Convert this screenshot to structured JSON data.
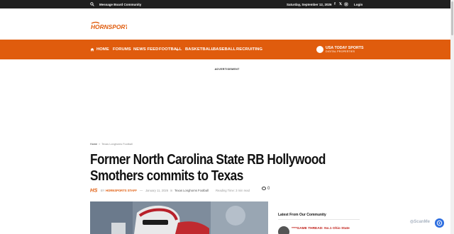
{
  "topbar": {
    "message_board": "Message Board Community",
    "date": "Saturday, September 12, 2026",
    "login": "Login",
    "social": [
      "facebook-icon",
      "x-icon",
      "instagram-icon"
    ]
  },
  "logo": {
    "text": "HORNSPORTS"
  },
  "nav": {
    "items": [
      "HOME",
      "FORUMS",
      "NEWS FEED",
      "FOOTBALL",
      "BASKETBALL",
      "BASEBALL",
      "RECRUITING"
    ],
    "partner_title": "USA TODAY SPORTS",
    "partner_sub": "DIGITAL PROPERTIES"
  },
  "advertisement": "ADVERTISEMENT",
  "breadcrumb": {
    "home": "Home",
    "separator": "»",
    "category": "Texas Longhorns Football"
  },
  "article": {
    "headline": "Former North Carolina State RB Hollywood Smothers commits to Texas",
    "by": "BY",
    "author": "HORNSPORTS STAFF",
    "dash": "—",
    "date": "January 11, 2026",
    "in": "in",
    "category": "Texas Longhorns Football",
    "read_time": "Reading Time: 3 min read",
    "comments": "0"
  },
  "sidebar": {
    "title": "Latest From Our Community",
    "items": [
      {
        "title": "****GAME THREAD: No.1 Ohio State"
      }
    ]
  },
  "scan_badge": "ScanMe",
  "colors": {
    "brand": "#e05c0d",
    "topbar": "#1f1f1f",
    "link": "#c0201a"
  }
}
